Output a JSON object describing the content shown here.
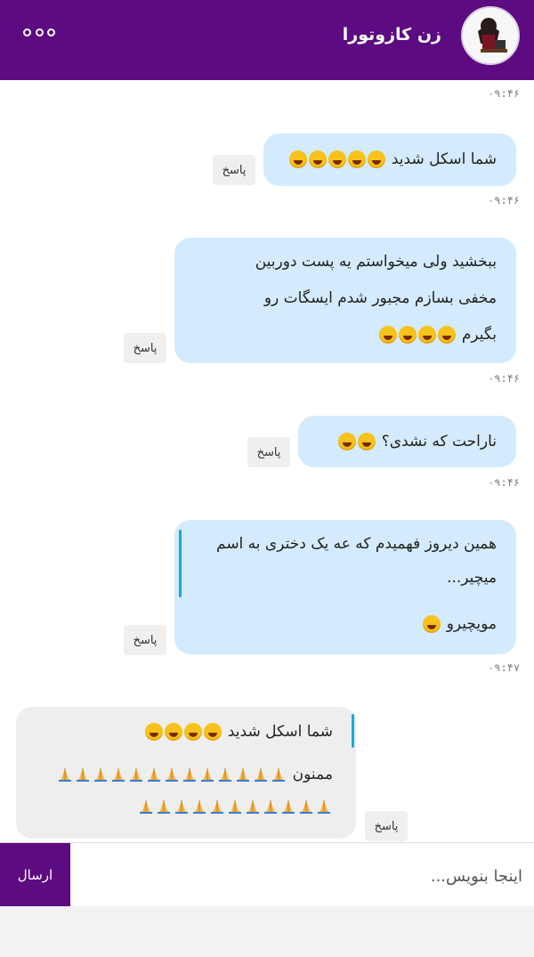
{
  "header": {
    "title": "زن کازوتورا",
    "menu_icon": "more-dots-icon",
    "avatar_icon": "avatar-image",
    "background": "#5c0b81"
  },
  "messages": [
    {
      "time_above": "۰۹:۴۶"
    },
    {
      "lines": [
        "شما اسکل شدید"
      ],
      "reply": "پاسخ",
      "time": "۰۹:۴۶"
    },
    {
      "lines": [
        "ببخشید ولی میخواستم یه پست دوربین",
        "مخفی بسازم مجبور شدم ایسگات رو",
        "بگیرم"
      ],
      "reply": "پاسخ",
      "time": "۰۹:۴۶"
    },
    {
      "lines": [
        "ناراحت که نشدی؟"
      ],
      "reply": "پاسخ",
      "time": "۰۹:۴۶"
    },
    {
      "quote": [
        "همین دیروز فهمیدم که عه یک دختری به اسم",
        "میچیر..."
      ],
      "lines": [
        "مویچیرو"
      ],
      "reply": "پاسخ",
      "time": "۰۹:۴۷"
    },
    {
      "quote": [
        "شما اسکل شدید"
      ],
      "lines": [
        "ممنون"
      ],
      "reply": "پاسخ"
    }
  ],
  "composer": {
    "placeholder": "اینجا بنویس...",
    "send_label": "ارسال"
  },
  "colors": {
    "outgoing_bubble": "#d3ebfd",
    "incoming_bubble": "#eeeeee",
    "quote_bar": "#18a8d8"
  }
}
